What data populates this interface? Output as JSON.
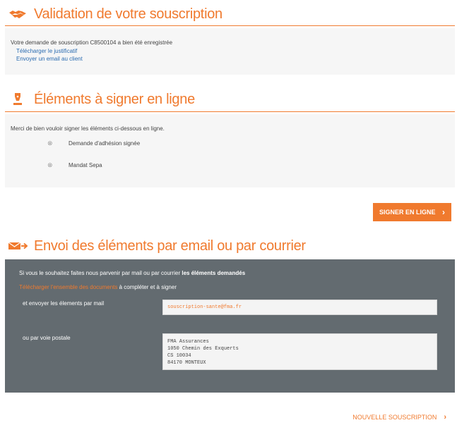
{
  "validation": {
    "title": "Validation de votre souscription",
    "icon": "handshake-icon",
    "message": "Votre demande de souscription C8500104 a bien été enregistrée",
    "link_justificatif": "Télécharger le justificatif",
    "link_email": "Envoyer un email au client"
  },
  "sign": {
    "title": "Éléments à signer en ligne",
    "icon": "pen-nib-icon",
    "intro": "Merci de bien vouloir signer les éléments ci-dessous en ligne.",
    "items": [
      {
        "label": "Demande d'adhésion signée"
      },
      {
        "label": "Mandat Sepa"
      }
    ],
    "button_label": "SIGNER EN LIGNE"
  },
  "send": {
    "title": "Envoi des éléments par email ou par courrier",
    "icon": "envelope-send-icon",
    "intro_prefix": "Si vous le souhaitez faites nous parvenir par mail ou par courrier ",
    "intro_bold": "les éléments demandés",
    "download_link": "Télécharger l'ensemble des documents",
    "download_suffix": " à compléter et à signer",
    "mail_label": "et envoyer les élements par mail",
    "mail_value": "souscription-sante@fma.fr",
    "postal_label": "ou par voie postale",
    "postal_lines": [
      "FMA Assurances",
      "1050 Chemin des Exquerts",
      "CS 10034",
      "84170 MONTEUX"
    ]
  },
  "footer": {
    "new_subscription": "NOUVELLE SOUSCRIPTION"
  },
  "colors": {
    "accent": "#f07a2e",
    "link": "#2a6bb0",
    "dark_panel": "#636b70"
  }
}
